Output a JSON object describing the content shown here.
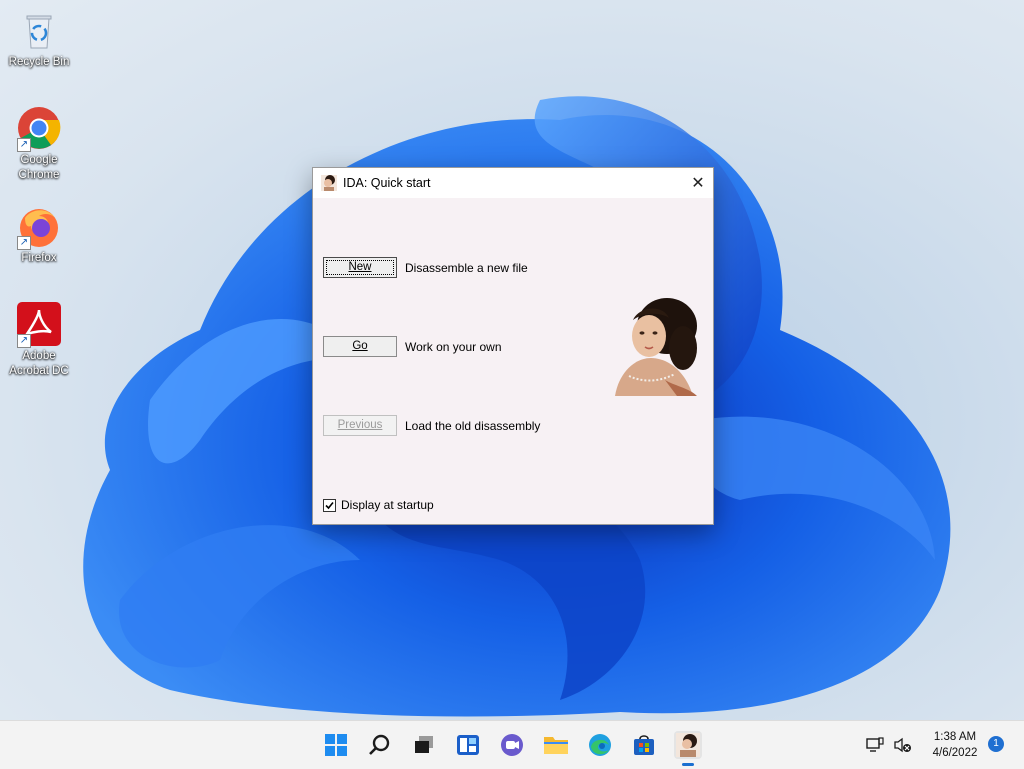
{
  "desktop": {
    "icons": [
      {
        "label": "Recycle Bin"
      },
      {
        "label": "Google Chrome"
      },
      {
        "label": "Firefox"
      },
      {
        "label": "Adobe Acrobat DC"
      }
    ]
  },
  "dialog": {
    "title": "IDA: Quick start",
    "close_glyph": "✕",
    "actions": [
      {
        "button": "New",
        "description": "Disassemble a new file",
        "enabled": true
      },
      {
        "button": "Go",
        "description": "Work on your own",
        "enabled": true
      },
      {
        "button": "Previous",
        "description": "Load the old disassembly",
        "enabled": false
      }
    ],
    "startup_checkbox": {
      "label": "Display at startup",
      "checked": true
    }
  },
  "taskbar": {
    "apps": [
      "start-icon",
      "search-icon",
      "task-view-icon",
      "widgets-icon",
      "teams-chat-icon",
      "file-explorer-icon",
      "edge-icon",
      "store-icon",
      "ida-icon"
    ],
    "clock": {
      "time": "1:38 AM",
      "date": "4/6/2022"
    },
    "notification_count": "1"
  },
  "colors": {
    "accent": "#1a6fd0",
    "wallpaper_blue": "#1560e6"
  }
}
